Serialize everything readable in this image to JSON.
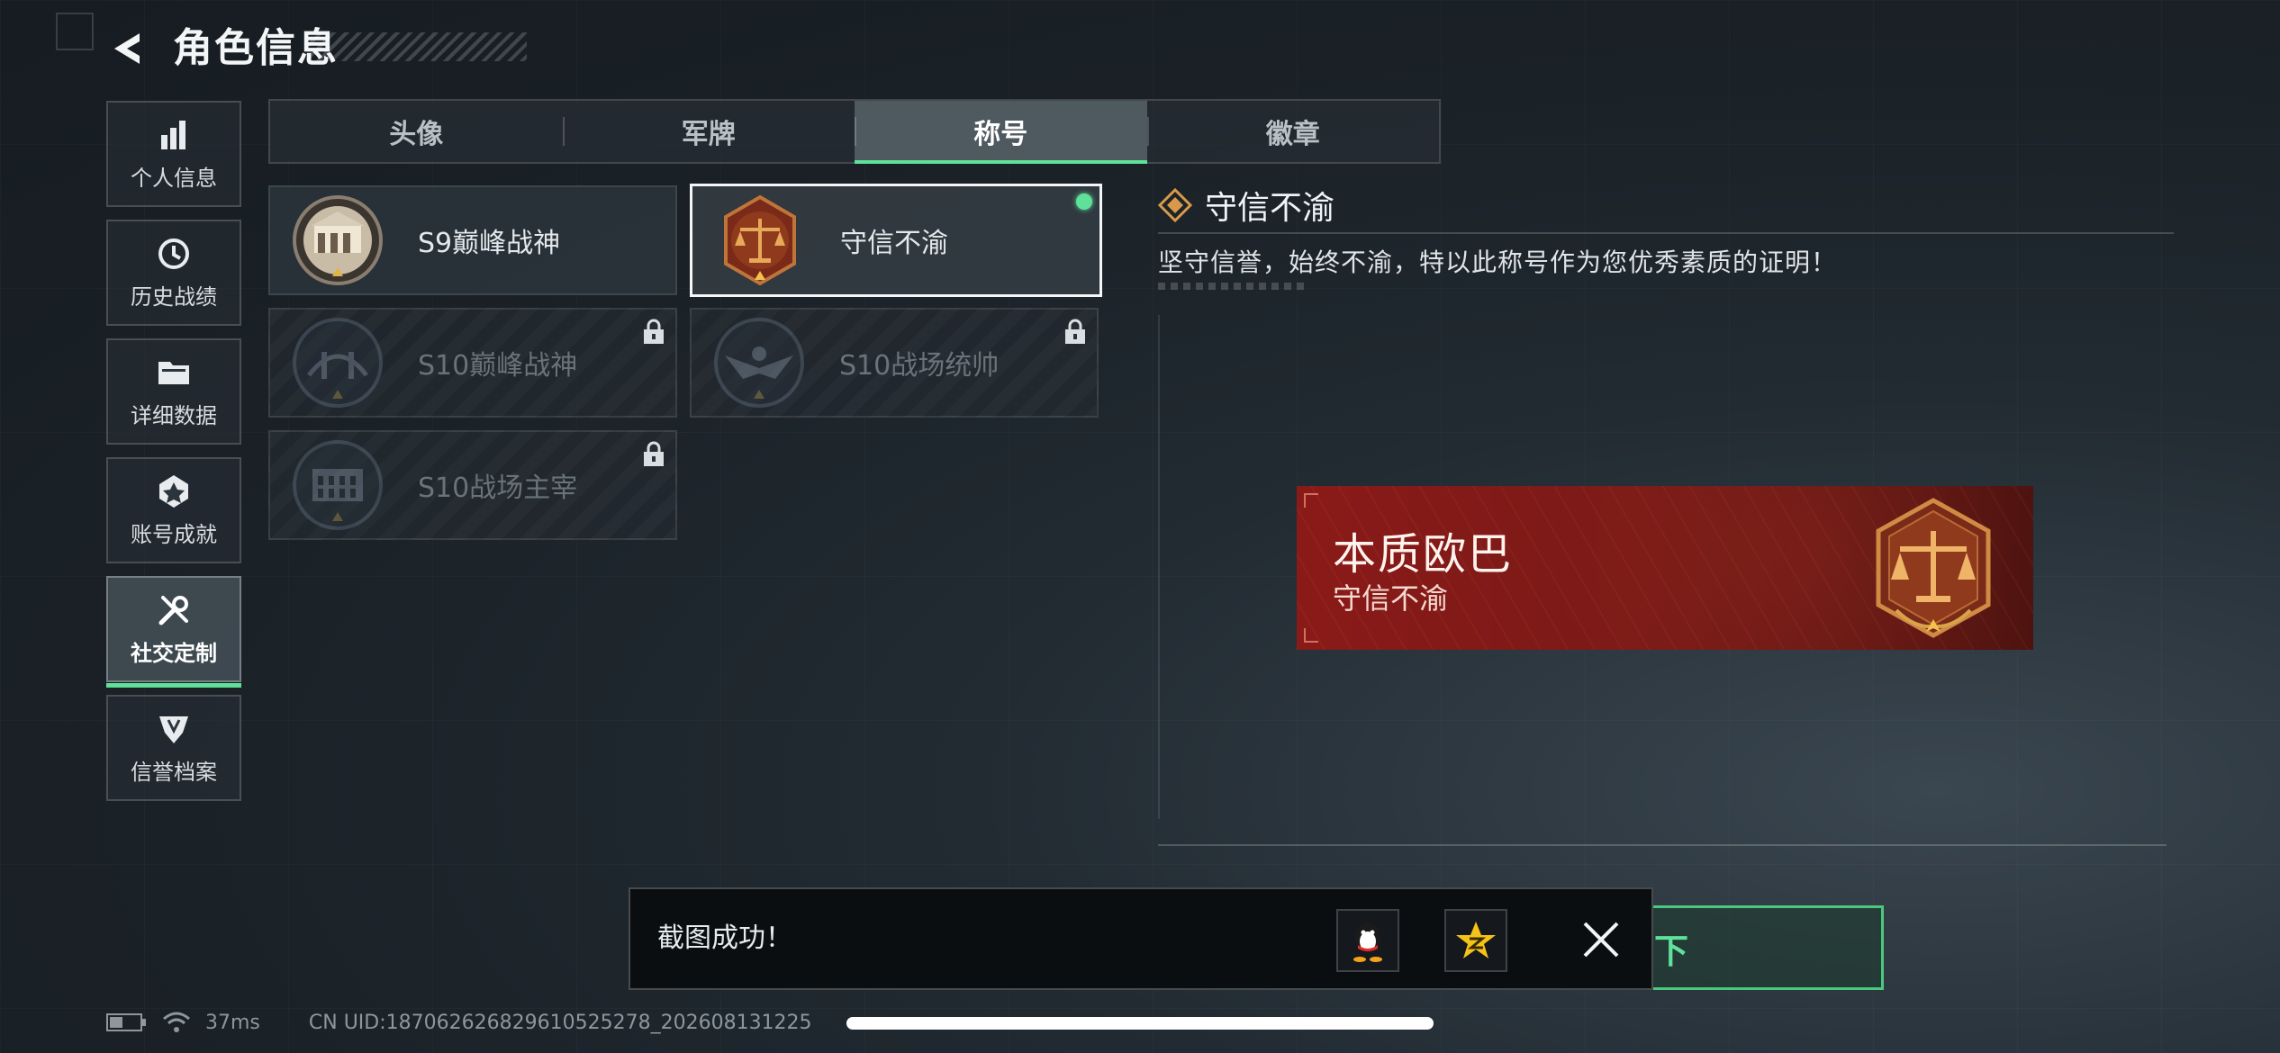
{
  "header": {
    "title": "角色信息"
  },
  "sidebar": {
    "items": [
      {
        "label": "个人信息",
        "icon": "bar-chart-icon",
        "active": false
      },
      {
        "label": "历史战绩",
        "icon": "clock-history-icon",
        "active": false
      },
      {
        "label": "详细数据",
        "icon": "folder-icon",
        "active": false
      },
      {
        "label": "账号成就",
        "icon": "achievement-icon",
        "active": false
      },
      {
        "label": "社交定制",
        "icon": "tools-icon",
        "active": true
      },
      {
        "label": "信誉档案",
        "icon": "credit-shield-icon",
        "active": false
      }
    ]
  },
  "tabs": [
    {
      "label": "头像",
      "active": false
    },
    {
      "label": "军牌",
      "active": false
    },
    {
      "label": "称号",
      "active": true
    },
    {
      "label": "徽章",
      "active": false
    }
  ],
  "titles": [
    {
      "name": "S9巅峰战神",
      "locked": false,
      "selected": false,
      "emblem": "fortress-emblem"
    },
    {
      "name": "守信不渝",
      "locked": false,
      "selected": true,
      "equipped": true,
      "emblem": "scales-emblem"
    },
    {
      "name": "S10巅峰战神",
      "locked": true,
      "selected": false,
      "emblem": "bridge-emblem"
    },
    {
      "name": "S10战场统帅",
      "locked": true,
      "selected": false,
      "emblem": "eagle-emblem"
    },
    {
      "name": "S10战场主宰",
      "locked": true,
      "selected": false,
      "emblem": "colosseum-emblem"
    }
  ],
  "detail": {
    "title": "守信不渝",
    "description": "坚守信誉，始终不渝，特以此称号作为您优秀素质的证明！"
  },
  "preview": {
    "player_name": "本质欧巴",
    "title": "守信不渝"
  },
  "unequip_label": "卸下",
  "toast": {
    "message": "截图成功！",
    "share_qq_icon": "qq-penguin-icon",
    "share_qzone_icon": "qzone-star-icon",
    "close_icon": "close-icon"
  },
  "status_bar": {
    "ping": "37ms",
    "uid": "CN UID:18706262682961052527­8_202608131225"
  },
  "colors": {
    "accent": "#5fe19a",
    "plate_red": "#8a1a18",
    "emblem_gold": "#d89a4a"
  }
}
